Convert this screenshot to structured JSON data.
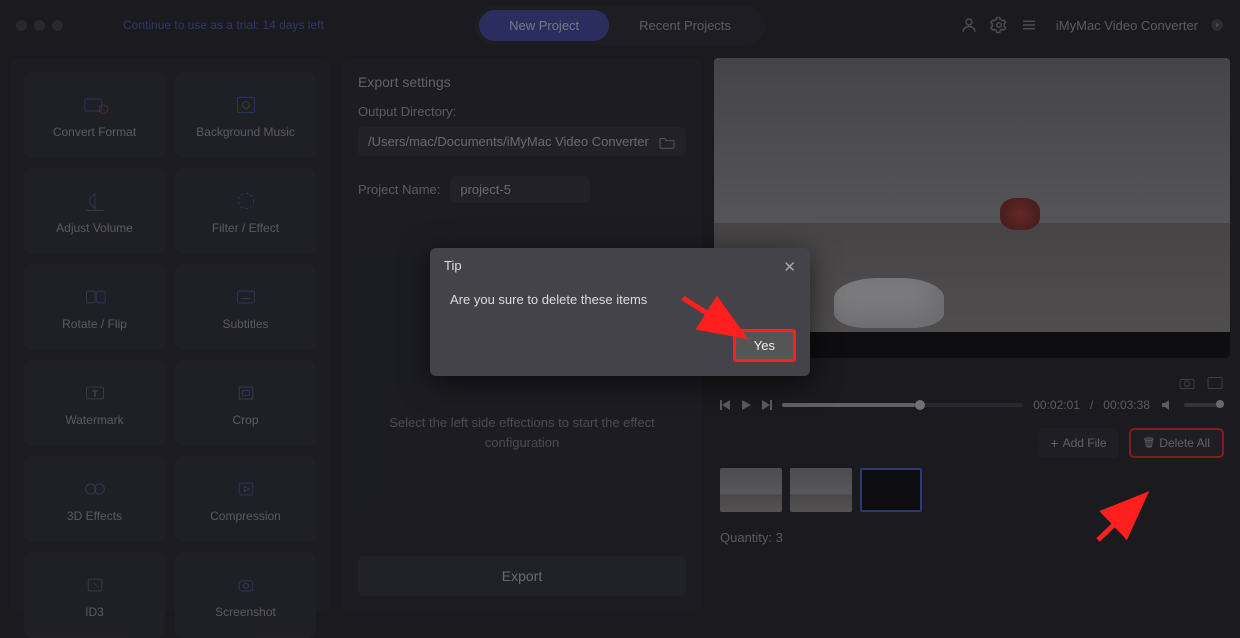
{
  "trial_text": "Continue to use as a trial: 14 days left",
  "tabs": {
    "new": "New Project",
    "recent": "Recent Projects"
  },
  "app_name": "iMyMac Video Converter",
  "tools": [
    "Convert Format",
    "Background Music",
    "Adjust Volume",
    "Filter / Effect",
    "Rotate / Flip",
    "Subtitles",
    "Watermark",
    "Crop",
    "3D Effects",
    "Compression",
    "ID3",
    "Screenshot"
  ],
  "export": {
    "heading": "Export settings",
    "dir_label": "Output Directory:",
    "dir_value": "/Users/mac/Documents/iMyMac Video Converter",
    "name_label": "Project Name:",
    "name_value": "project-5",
    "helper": "Select the left side effections to start the effect configuration",
    "button": "Export"
  },
  "player": {
    "current": "00:02:01",
    "total": "00:03:38"
  },
  "files": {
    "add": "Add File",
    "delete_all": "Delete All",
    "quantity_label": "Quantity:",
    "quantity": 3
  },
  "modal": {
    "title": "Tip",
    "message": "Are you sure to delete these items",
    "yes": "Yes"
  }
}
